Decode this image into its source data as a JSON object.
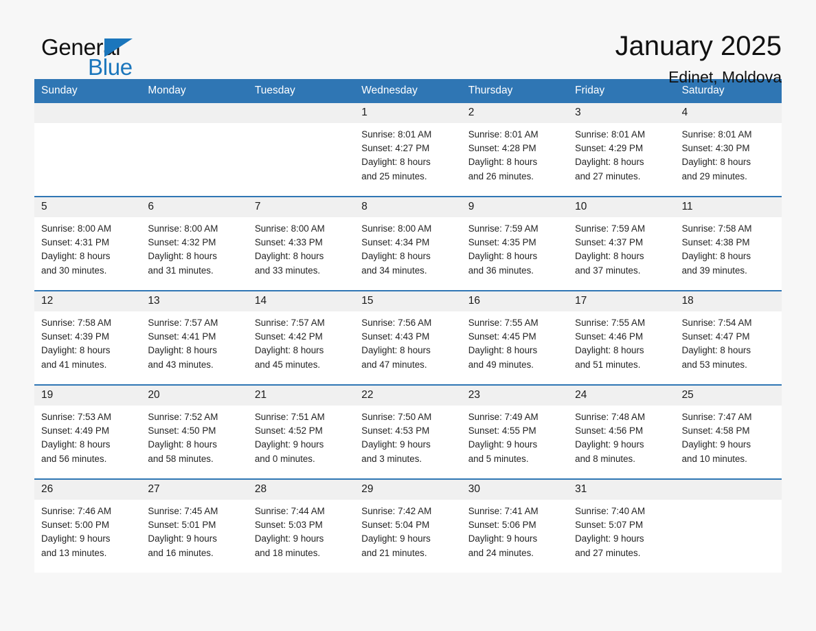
{
  "brand": {
    "name_part1": "General",
    "name_part2": "Blue",
    "triangle_color": "#1b76bc"
  },
  "header": {
    "month_title": "January 2025",
    "location": "Edinet, Moldova"
  },
  "theme": {
    "header_blue": "#2f76b4",
    "daynum_gray": "#f0f0f0",
    "page_bg": "#f7f7f7"
  },
  "calendar": {
    "weekdays": [
      "Sunday",
      "Monday",
      "Tuesday",
      "Wednesday",
      "Thursday",
      "Friday",
      "Saturday"
    ],
    "weeks": [
      [
        {
          "day": "",
          "info": ""
        },
        {
          "day": "",
          "info": ""
        },
        {
          "day": "",
          "info": ""
        },
        {
          "day": "1",
          "info": "Sunrise: 8:01 AM\nSunset: 4:27 PM\nDaylight: 8 hours\nand 25 minutes."
        },
        {
          "day": "2",
          "info": "Sunrise: 8:01 AM\nSunset: 4:28 PM\nDaylight: 8 hours\nand 26 minutes."
        },
        {
          "day": "3",
          "info": "Sunrise: 8:01 AM\nSunset: 4:29 PM\nDaylight: 8 hours\nand 27 minutes."
        },
        {
          "day": "4",
          "info": "Sunrise: 8:01 AM\nSunset: 4:30 PM\nDaylight: 8 hours\nand 29 minutes."
        }
      ],
      [
        {
          "day": "5",
          "info": "Sunrise: 8:00 AM\nSunset: 4:31 PM\nDaylight: 8 hours\nand 30 minutes."
        },
        {
          "day": "6",
          "info": "Sunrise: 8:00 AM\nSunset: 4:32 PM\nDaylight: 8 hours\nand 31 minutes."
        },
        {
          "day": "7",
          "info": "Sunrise: 8:00 AM\nSunset: 4:33 PM\nDaylight: 8 hours\nand 33 minutes."
        },
        {
          "day": "8",
          "info": "Sunrise: 8:00 AM\nSunset: 4:34 PM\nDaylight: 8 hours\nand 34 minutes."
        },
        {
          "day": "9",
          "info": "Sunrise: 7:59 AM\nSunset: 4:35 PM\nDaylight: 8 hours\nand 36 minutes."
        },
        {
          "day": "10",
          "info": "Sunrise: 7:59 AM\nSunset: 4:37 PM\nDaylight: 8 hours\nand 37 minutes."
        },
        {
          "day": "11",
          "info": "Sunrise: 7:58 AM\nSunset: 4:38 PM\nDaylight: 8 hours\nand 39 minutes."
        }
      ],
      [
        {
          "day": "12",
          "info": "Sunrise: 7:58 AM\nSunset: 4:39 PM\nDaylight: 8 hours\nand 41 minutes."
        },
        {
          "day": "13",
          "info": "Sunrise: 7:57 AM\nSunset: 4:41 PM\nDaylight: 8 hours\nand 43 minutes."
        },
        {
          "day": "14",
          "info": "Sunrise: 7:57 AM\nSunset: 4:42 PM\nDaylight: 8 hours\nand 45 minutes."
        },
        {
          "day": "15",
          "info": "Sunrise: 7:56 AM\nSunset: 4:43 PM\nDaylight: 8 hours\nand 47 minutes."
        },
        {
          "day": "16",
          "info": "Sunrise: 7:55 AM\nSunset: 4:45 PM\nDaylight: 8 hours\nand 49 minutes."
        },
        {
          "day": "17",
          "info": "Sunrise: 7:55 AM\nSunset: 4:46 PM\nDaylight: 8 hours\nand 51 minutes."
        },
        {
          "day": "18",
          "info": "Sunrise: 7:54 AM\nSunset: 4:47 PM\nDaylight: 8 hours\nand 53 minutes."
        }
      ],
      [
        {
          "day": "19",
          "info": "Sunrise: 7:53 AM\nSunset: 4:49 PM\nDaylight: 8 hours\nand 56 minutes."
        },
        {
          "day": "20",
          "info": "Sunrise: 7:52 AM\nSunset: 4:50 PM\nDaylight: 8 hours\nand 58 minutes."
        },
        {
          "day": "21",
          "info": "Sunrise: 7:51 AM\nSunset: 4:52 PM\nDaylight: 9 hours\nand 0 minutes."
        },
        {
          "day": "22",
          "info": "Sunrise: 7:50 AM\nSunset: 4:53 PM\nDaylight: 9 hours\nand 3 minutes."
        },
        {
          "day": "23",
          "info": "Sunrise: 7:49 AM\nSunset: 4:55 PM\nDaylight: 9 hours\nand 5 minutes."
        },
        {
          "day": "24",
          "info": "Sunrise: 7:48 AM\nSunset: 4:56 PM\nDaylight: 9 hours\nand 8 minutes."
        },
        {
          "day": "25",
          "info": "Sunrise: 7:47 AM\nSunset: 4:58 PM\nDaylight: 9 hours\nand 10 minutes."
        }
      ],
      [
        {
          "day": "26",
          "info": "Sunrise: 7:46 AM\nSunset: 5:00 PM\nDaylight: 9 hours\nand 13 minutes."
        },
        {
          "day": "27",
          "info": "Sunrise: 7:45 AM\nSunset: 5:01 PM\nDaylight: 9 hours\nand 16 minutes."
        },
        {
          "day": "28",
          "info": "Sunrise: 7:44 AM\nSunset: 5:03 PM\nDaylight: 9 hours\nand 18 minutes."
        },
        {
          "day": "29",
          "info": "Sunrise: 7:42 AM\nSunset: 5:04 PM\nDaylight: 9 hours\nand 21 minutes."
        },
        {
          "day": "30",
          "info": "Sunrise: 7:41 AM\nSunset: 5:06 PM\nDaylight: 9 hours\nand 24 minutes."
        },
        {
          "day": "31",
          "info": "Sunrise: 7:40 AM\nSunset: 5:07 PM\nDaylight: 9 hours\nand 27 minutes."
        },
        {
          "day": "",
          "info": ""
        }
      ]
    ]
  }
}
